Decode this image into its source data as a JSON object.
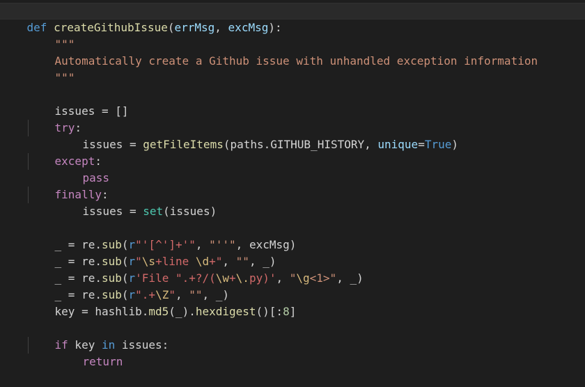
{
  "editor": {
    "language": "python",
    "theme_colors": {
      "background": "#1e1e1e",
      "keyword": "#569cd6",
      "control": "#c586c0",
      "function": "#dcdcaa",
      "parameter": "#9cdcfe",
      "string": "#ce9178",
      "number": "#b5cea8",
      "builtin": "#4ec9b0",
      "regex": "#d16969",
      "escape": "#d7ba7d"
    },
    "code": {
      "l1": {
        "def": "def",
        "name": "createGithubIssue",
        "p1": "errMsg",
        "p2": "excMsg",
        "punct_open": "(",
        "comma": ", ",
        "punct_close": "):"
      },
      "l2": {
        "doc": "\"\"\""
      },
      "l3": {
        "doc": "Automatically create a Github issue with unhandled exception information"
      },
      "l4": {
        "doc": "\"\"\""
      },
      "l6": {
        "a": "issues = []"
      },
      "l7": {
        "kw": "try",
        "colon": ":"
      },
      "l8": {
        "a": "issues = ",
        "fn": "getFileItems",
        "b": "(paths.GITHUB_HISTORY, ",
        "param": "unique",
        "eq": "=",
        "val": "True",
        "c": ")"
      },
      "l9": {
        "kw": "except",
        "colon": ":"
      },
      "l10": {
        "kw": "pass"
      },
      "l11": {
        "kw": "finally",
        "colon": ":"
      },
      "l12": {
        "a": "issues = ",
        "fn": "set",
        "b": "(issues)"
      },
      "l14": {
        "a": "_ = re.",
        "fn": "sub",
        "b": "(",
        "rprefix": "r",
        "q1": "\"",
        "rx": "'[^']+'",
        "q2": "\"",
        "c": ", ",
        "s2": "\"''\"",
        "d": ", excMsg)"
      },
      "l15": {
        "a": "_ = re.",
        "fn": "sub",
        "b": "(",
        "rprefix": "r",
        "q1": "\"",
        "esc1": "\\s",
        "rx1": "+line ",
        "esc2": "\\d",
        "rx2": "+",
        "q2": "\"",
        "c": ", ",
        "s2": "\"\"",
        "d": ", _)"
      },
      "l16": {
        "a": "_ = re.",
        "fn": "sub",
        "b": "(",
        "rprefix": "r",
        "q1": "'",
        "rx1": "File \".+?/(",
        "esc1": "\\w",
        "rx2": "+",
        "esc2": "\\.",
        "rx3": "py)",
        "q2": "'",
        "c": ", ",
        "s2a": "\"",
        "s2esc": "\\g",
        "s2b": "<1>\"",
        "d": ", _)"
      },
      "l17": {
        "a": "_ = re.",
        "fn": "sub",
        "b": "(",
        "rprefix": "r",
        "q1": "\"",
        "rx1": ".+",
        "esc1": "\\Z",
        "q2": "\"",
        "c": ", ",
        "s2": "\"\"",
        "d": ", _)"
      },
      "l18": {
        "a": "key = hashlib.",
        "fn": "md5",
        "b": "(_).",
        "fn2": "hexdigest",
        "c": "()[:",
        "num": "8",
        "d": "]"
      },
      "l20": {
        "kw": "if",
        "a": " key ",
        "kw2": "in",
        "b": " issues:"
      },
      "l21": {
        "kw": "return"
      }
    }
  }
}
